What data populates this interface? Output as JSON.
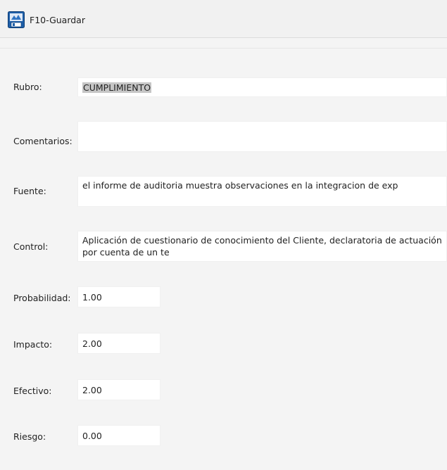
{
  "toolbar": {
    "save_label": "F10-Guardar",
    "save_icon": "save-form-icon"
  },
  "form": {
    "rubro": {
      "label": "Rubro:",
      "value": "CUMPLIMIENTO"
    },
    "comentarios": {
      "label": "Comentarios:",
      "value": ""
    },
    "fuente": {
      "label": "Fuente:",
      "value": "el informe de auditoria muestra observaciones en la integracion de exp"
    },
    "control": {
      "label": "Control:",
      "value": "Aplicación de cuestionario de conocimiento del Cliente, declaratoria de actuación por cuenta de un te"
    },
    "probabilidad": {
      "label": "Probabilidad:",
      "value": "1.00"
    },
    "impacto": {
      "label": "Impacto:",
      "value": "2.00"
    },
    "efectivo": {
      "label": "Efectivo:",
      "value": "2.00"
    },
    "riesgo": {
      "label": "Riesgo:",
      "value": "0.00"
    }
  },
  "colors": {
    "background": "#f4f4f4",
    "field": "#ffffff",
    "selection": "#c6c6c6"
  }
}
